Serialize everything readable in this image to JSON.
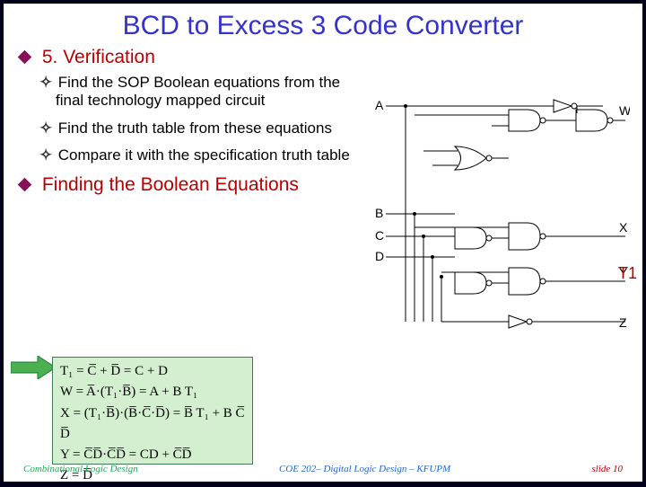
{
  "title": "BCD to Excess 3 Code Converter",
  "section1": "5. Verification",
  "bullets": [
    "Find the SOP Boolean equations from the final technology mapped circuit",
    "Find the truth table from these equations",
    "Compare it with the specification truth table"
  ],
  "section2": "Finding the Boolean Equations",
  "circuit_labels": {
    "A": "A",
    "B": "B",
    "C": "C",
    "D": "D",
    "W": "W",
    "X": "X",
    "Y": "Y",
    "Z": "Z",
    "T1": "T1"
  },
  "equations": {
    "t1": "T₁ = C̅ + D̅ = C + D",
    "w": "W = A̅·(T₁·B̅) = A + B T₁",
    "x": "X = (T₁·B̅)·(B̅·C̅·D̅) = B̅ T₁ + B C̅ D̅",
    "y": "Y = C̅D̅·C̅D̅ = CD + C̅D̅",
    "z": "Z = D̅"
  },
  "footer": {
    "left": "Combinational Logic Design",
    "mid": "COE 202– Digital Logic Design – KFUPM",
    "right": "slide 10"
  }
}
